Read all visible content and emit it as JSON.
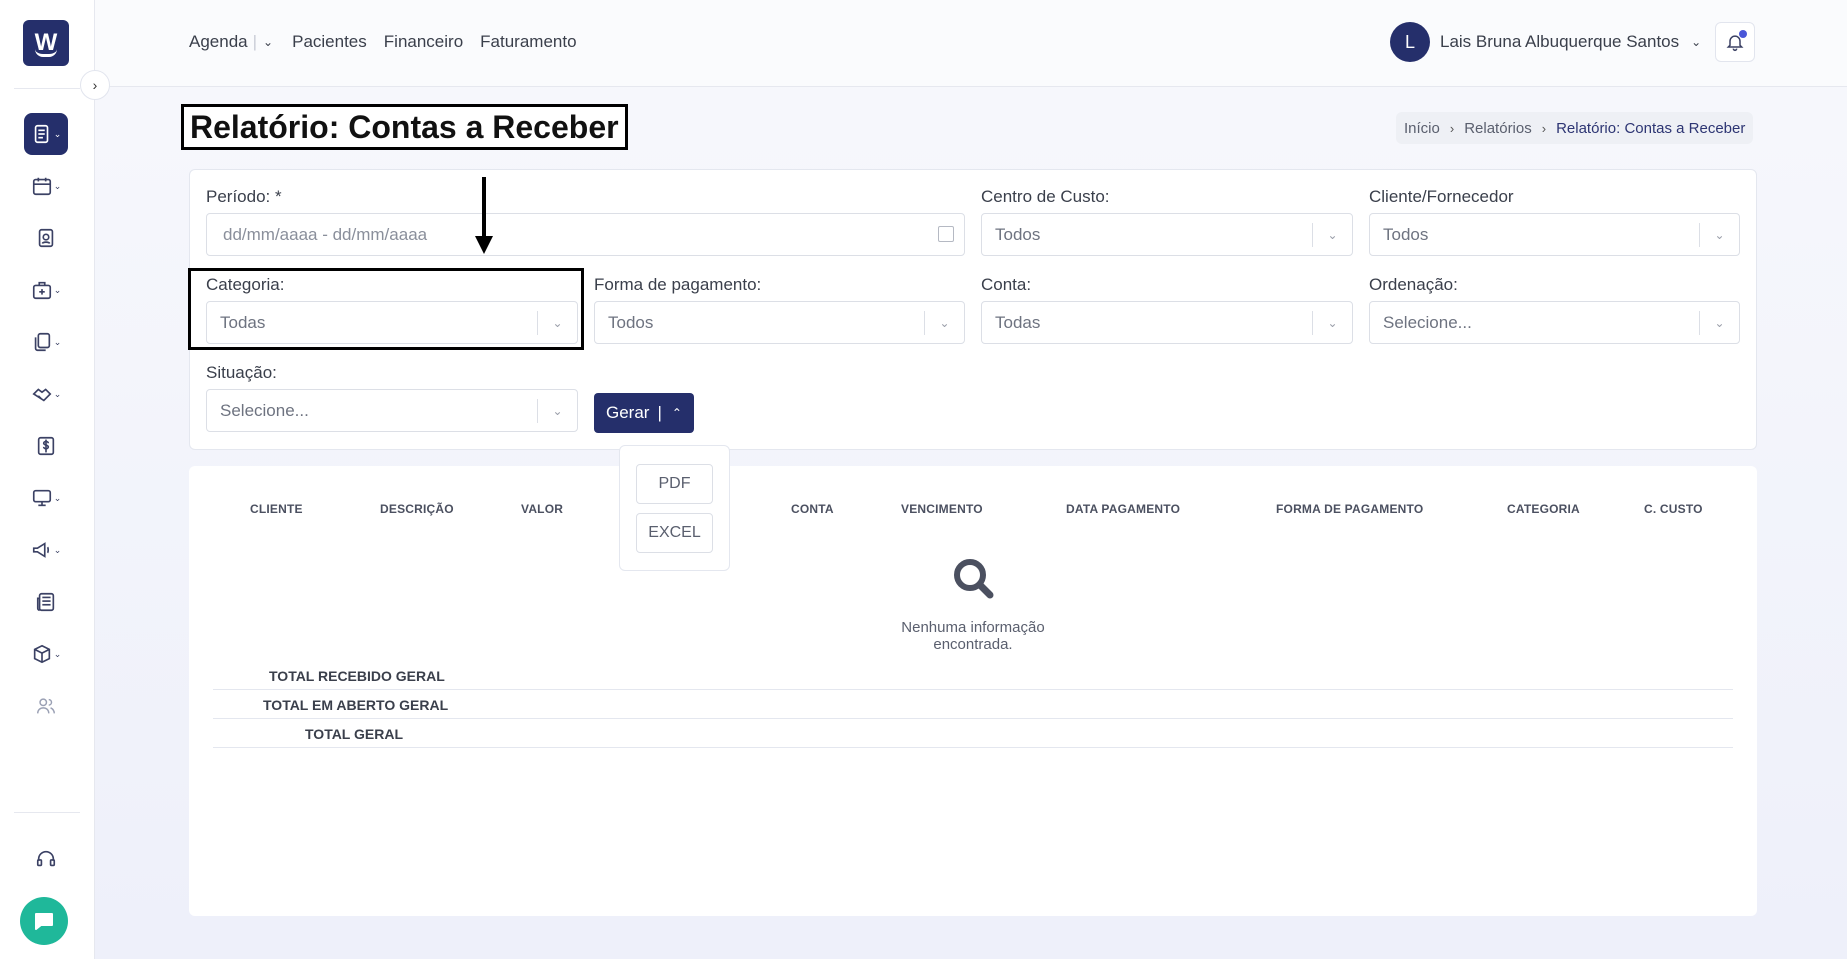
{
  "nav": {
    "agenda": "Agenda",
    "pacientes": "Pacientes",
    "financeiro": "Financeiro",
    "faturamento": "Faturamento",
    "divider": "|"
  },
  "user": {
    "initial": "L",
    "name": "Lais Bruna Albuquerque Santos"
  },
  "logo": {
    "letter": "W"
  },
  "page": {
    "title": "Relatório: Contas a Receber"
  },
  "breadcrumb": {
    "inicio": "Início",
    "relatorios": "Relatórios",
    "current": "Relatório: Contas a Receber"
  },
  "filters": {
    "periodo_label": "Período: *",
    "periodo_placeholder": "dd/mm/aaaa - dd/mm/aaaa",
    "centro_label": "Centro de Custo:",
    "centro_value": "Todos",
    "cliente_label": "Cliente/Fornecedor",
    "cliente_value": "Todos",
    "categoria_label": "Categoria:",
    "categoria_value": "Todas",
    "forma_label": "Forma de pagamento:",
    "forma_value": "Todos",
    "conta_label": "Conta:",
    "conta_value": "Todas",
    "ordenacao_label": "Ordenação:",
    "ordenacao_value": "Selecione...",
    "situacao_label": "Situação:",
    "situacao_value": "Selecione..."
  },
  "gerar": {
    "label": "Gerar",
    "bar": "|",
    "options": [
      "PDF",
      "EXCEL"
    ]
  },
  "table": {
    "columns": [
      "CLIENTE",
      "DESCRIÇÃO",
      "VALOR",
      "CONTA",
      "VENCIMENTO",
      "DATA PAGAMENTO",
      "FORMA DE PAGAMENTO",
      "CATEGORIA",
      "C. CUSTO"
    ],
    "empty_text": "Nenhuma informação encontrada.",
    "totals": [
      "TOTAL RECEBIDO GERAL",
      "TOTAL EM ABERTO GERAL",
      "TOTAL GERAL"
    ]
  },
  "colors": {
    "primary": "#252f6b",
    "chat": "#1fb89a",
    "notification_dot": "#4a56d8"
  },
  "icons": [
    "reports-icon",
    "calendar-icon",
    "patient-card-icon",
    "clinic-icon",
    "documents-icon",
    "handshake-icon",
    "dollar-icon",
    "monitor-icon",
    "megaphone-icon",
    "newspaper-icon",
    "box-icon",
    "users-icon",
    "headset-icon",
    "chat-icon",
    "bell-icon",
    "search-icon"
  ]
}
